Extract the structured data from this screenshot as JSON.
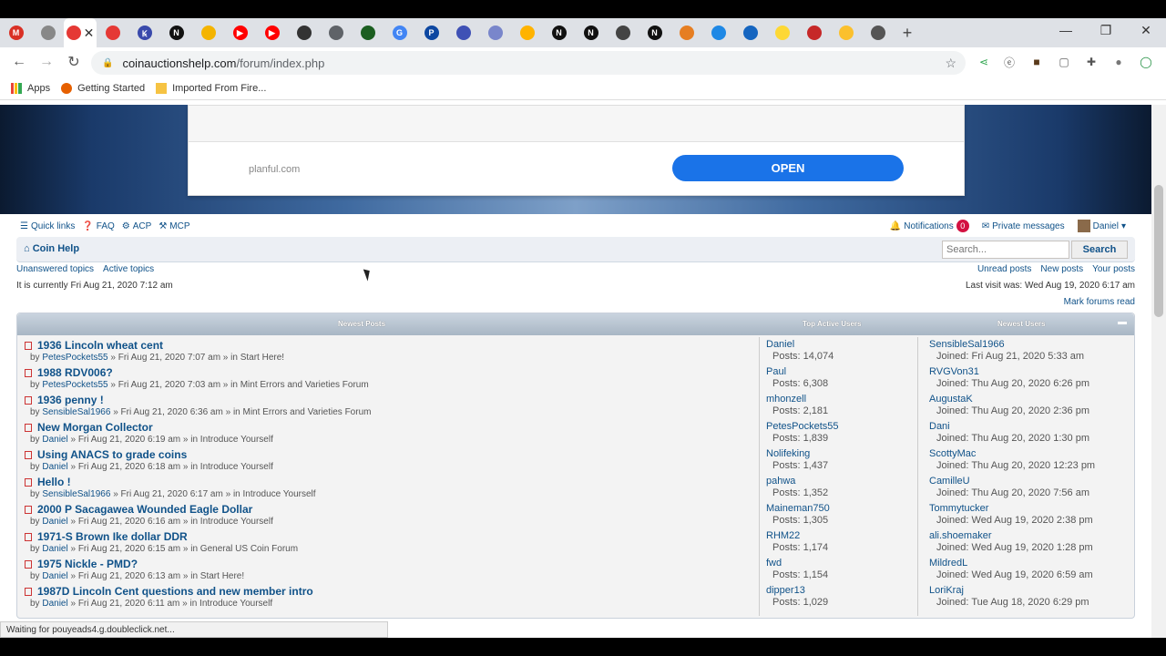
{
  "browser": {
    "url_host": "coinauctionshelp.com",
    "url_path": "/forum/index.php",
    "tab_close": "✕",
    "new_tab": "+",
    "tab_favicons": [
      {
        "label": "M",
        "color": "#d93025"
      },
      {
        "label": "",
        "color": "#888888"
      },
      {
        "label": "",
        "color": "#e53935"
      },
      {
        "label": "",
        "color": "#e53935"
      },
      {
        "label": "Ꝃ",
        "color": "#3949ab"
      },
      {
        "label": "N",
        "color": "#111111"
      },
      {
        "label": "",
        "color": "#f4b400"
      },
      {
        "label": "▶",
        "color": "#ff0000"
      },
      {
        "label": "▶",
        "color": "#ff0000"
      },
      {
        "label": "",
        "color": "#333333"
      },
      {
        "label": "",
        "color": "#5f6368"
      },
      {
        "label": "",
        "color": "#1b5e20"
      },
      {
        "label": "G",
        "color": "#4285f4"
      },
      {
        "label": "P",
        "color": "#0d47a1"
      },
      {
        "label": "",
        "color": "#3f51b5"
      },
      {
        "label": "",
        "color": "#7986cb"
      },
      {
        "label": "",
        "color": "#ffb300"
      },
      {
        "label": "N",
        "color": "#111111"
      },
      {
        "label": "N",
        "color": "#111111"
      },
      {
        "label": "",
        "color": "#444444"
      },
      {
        "label": "N",
        "color": "#111111"
      },
      {
        "label": "",
        "color": "#e67e22"
      },
      {
        "label": "",
        "color": "#1e88e5"
      },
      {
        "label": "",
        "color": "#1565c0"
      },
      {
        "label": "",
        "color": "#fdd835"
      },
      {
        "label": "",
        "color": "#c62828"
      },
      {
        "label": "",
        "color": "#fbc02d"
      },
      {
        "label": "",
        "color": "#555555"
      }
    ],
    "bookmarks": {
      "apps": "Apps",
      "getting_started": "Getting Started",
      "imported": "Imported From Fire..."
    },
    "status_text": "Waiting for pouyeads4.g.doubleclick.net..."
  },
  "ad": {
    "domain": "planful.com",
    "open_label": "OPEN"
  },
  "forum": {
    "nav": {
      "quick_links": "Quick links",
      "faq": "FAQ",
      "acp": "ACP",
      "mcp": "MCP",
      "notifications": "Notifications",
      "notif_count": "0",
      "private_messages": "Private messages",
      "user": "Daniel"
    },
    "breadcrumb": "Coin Help",
    "search_placeholder": "Search...",
    "search_button": "Search",
    "links_left": {
      "unanswered": "Unanswered topics",
      "active": "Active topics"
    },
    "links_right": {
      "unread": "Unread posts",
      "new": "New posts",
      "your": "Your posts"
    },
    "current_time": "It is currently Fri Aug 21, 2020 7:12 am",
    "last_visit": "Last visit was: Wed Aug 19, 2020 6:17 am",
    "mark_read": "Mark forums read",
    "stats": {
      "headers": {
        "newest_posts": "Newest Posts",
        "top_active": "Top Active Users",
        "newest_users": "Newest Users"
      },
      "posts": [
        {
          "title": "1936 Lincoln wheat cent",
          "by": "by",
          "user": "PetesPockets55",
          "meta": "» Fri Aug 21, 2020 7:07 am » in Start Here!"
        },
        {
          "title": "1988 RDV006?",
          "by": "by",
          "user": "PetesPockets55",
          "meta": "» Fri Aug 21, 2020 7:03 am » in Mint Errors and Varieties Forum"
        },
        {
          "title": "1936 penny !",
          "by": "by",
          "user": "SensibleSal1966",
          "meta": "» Fri Aug 21, 2020 6:36 am » in Mint Errors and Varieties Forum"
        },
        {
          "title": "New Morgan Collector",
          "by": "by",
          "user": "Daniel",
          "meta": "» Fri Aug 21, 2020 6:19 am » in Introduce Yourself"
        },
        {
          "title": "Using ANACS to grade coins",
          "by": "by",
          "user": "Daniel",
          "meta": "» Fri Aug 21, 2020 6:18 am » in Introduce Yourself"
        },
        {
          "title": "Hello !",
          "by": "by",
          "user": "SensibleSal1966",
          "meta": "» Fri Aug 21, 2020 6:17 am » in Introduce Yourself"
        },
        {
          "title": "2000 P Sacagawea Wounded Eagle Dollar",
          "by": "by",
          "user": "Daniel",
          "meta": "» Fri Aug 21, 2020 6:16 am » in Introduce Yourself"
        },
        {
          "title": "1971-S Brown Ike dollar DDR",
          "by": "by",
          "user": "Daniel",
          "meta": "» Fri Aug 21, 2020 6:15 am » in General US Coin Forum"
        },
        {
          "title": "1975 Nickle - PMD?",
          "by": "by",
          "user": "Daniel",
          "meta": "» Fri Aug 21, 2020 6:13 am » in Start Here!"
        },
        {
          "title": "1987D Lincoln Cent questions and new member intro",
          "by": "by",
          "user": "Daniel",
          "meta": "» Fri Aug 21, 2020 6:11 am » in Introduce Yourself"
        }
      ],
      "top_users": [
        {
          "name": "Daniel",
          "posts": "Posts: 14,074"
        },
        {
          "name": "Paul",
          "posts": "Posts: 6,308"
        },
        {
          "name": "mhonzell",
          "posts": "Posts: 2,181"
        },
        {
          "name": "PetesPockets55",
          "posts": "Posts: 1,839"
        },
        {
          "name": "Nolifeking",
          "posts": "Posts: 1,437"
        },
        {
          "name": "pahwa",
          "posts": "Posts: 1,352"
        },
        {
          "name": "Maineman750",
          "posts": "Posts: 1,305"
        },
        {
          "name": "RHM22",
          "posts": "Posts: 1,174"
        },
        {
          "name": "fwd",
          "posts": "Posts: 1,154"
        },
        {
          "name": "dipper13",
          "posts": "Posts: 1,029"
        }
      ],
      "newest_users": [
        {
          "name": "SensibleSal1966",
          "joined": "Joined: Fri Aug 21, 2020 5:33 am"
        },
        {
          "name": "RVGVon31",
          "joined": "Joined: Thu Aug 20, 2020 6:26 pm"
        },
        {
          "name": "AugustaK",
          "joined": "Joined: Thu Aug 20, 2020 2:36 pm"
        },
        {
          "name": "Dani",
          "joined": "Joined: Thu Aug 20, 2020 1:30 pm"
        },
        {
          "name": "ScottyMac",
          "joined": "Joined: Thu Aug 20, 2020 12:23 pm"
        },
        {
          "name": "CamilleU",
          "joined": "Joined: Thu Aug 20, 2020 7:56 am"
        },
        {
          "name": "Tommytucker",
          "joined": "Joined: Wed Aug 19, 2020 2:38 pm"
        },
        {
          "name": "ali.shoemaker",
          "joined": "Joined: Wed Aug 19, 2020 1:28 pm"
        },
        {
          "name": "MildredL",
          "joined": "Joined: Wed Aug 19, 2020 6:59 am"
        },
        {
          "name": "LoriKraj",
          "joined": "Joined: Tue Aug 18, 2020 6:29 pm"
        }
      ]
    }
  },
  "colors": {
    "link": "#105289",
    "accent_button": "#1a73e8",
    "badge": "#d31141"
  }
}
